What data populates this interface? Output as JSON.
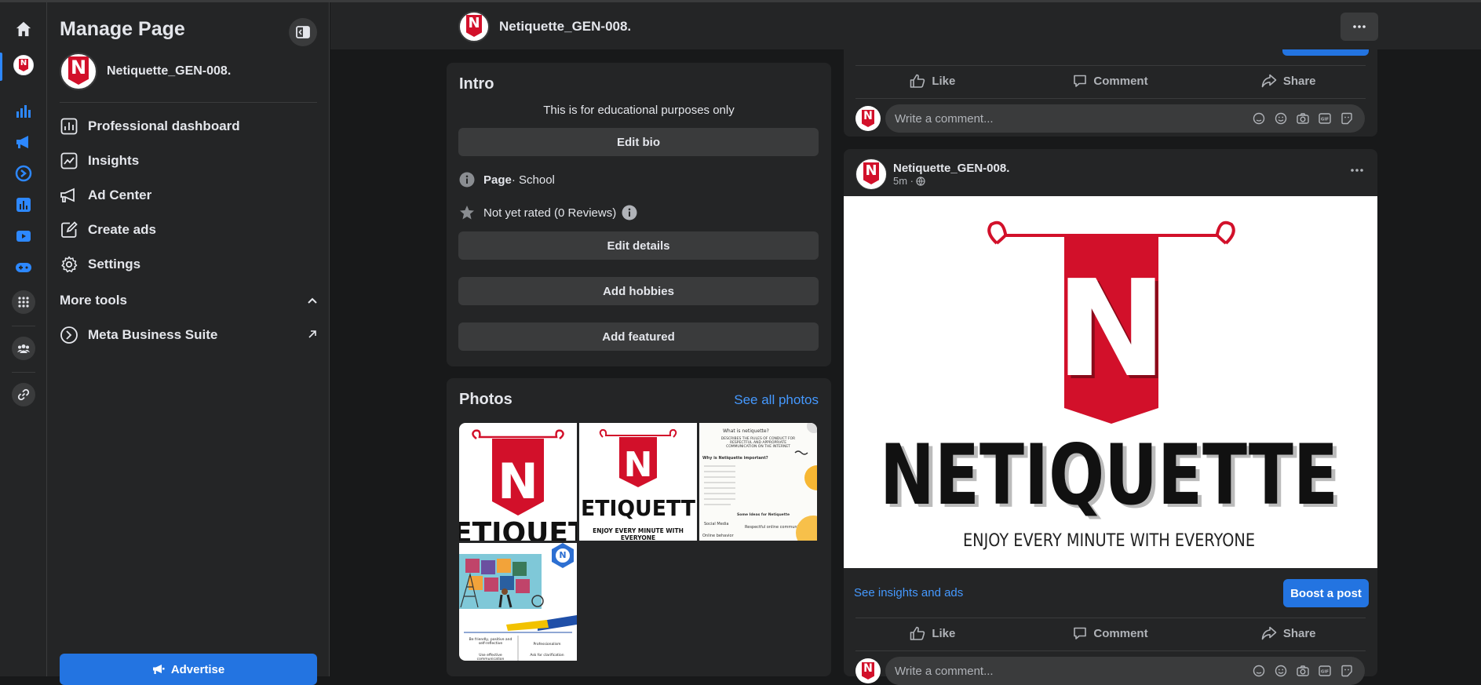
{
  "colors": {
    "accent": "#2374e1",
    "link": "#4599ff",
    "brand_red": "#d2102a",
    "bg": "#18191a",
    "surface": "#242526"
  },
  "rail": {
    "icons": [
      "home-icon",
      "page-avatar",
      "insights-bar-chart-icon",
      "ad-megaphone-icon",
      "meta-business-suite-icon",
      "analytics-icon",
      "video-play-icon",
      "gaming-controller-icon",
      "apps-grid-icon",
      "groups-icon",
      "link-icon"
    ]
  },
  "sidebar": {
    "title": "Manage Page",
    "page_name": "Netiquette_GEN-008.",
    "items": [
      {
        "label": "Professional dashboard",
        "icon": "dashboard-icon"
      },
      {
        "label": "Insights",
        "icon": "insights-icon"
      },
      {
        "label": "Ad Center",
        "icon": "megaphone-icon"
      },
      {
        "label": "Create ads",
        "icon": "pencil-icon"
      },
      {
        "label": "Settings",
        "icon": "gear-icon"
      }
    ],
    "more_tools_label": "More tools",
    "tools": [
      {
        "label": "Meta Business Suite",
        "icon": "meta-business-suite-icon"
      }
    ],
    "advertise_label": "Advertise"
  },
  "header": {
    "page_name": "Netiquette_GEN-008."
  },
  "intro": {
    "title": "Intro",
    "bio": "This is for educational purposes only",
    "edit_bio": "Edit bio",
    "category_bold": "Page",
    "category_rest": " · School",
    "rating": "Not yet rated (0 Reviews)",
    "edit_details": "Edit details",
    "add_hobbies": "Add hobbies",
    "add_featured": "Add featured"
  },
  "photos": {
    "title": "Photos",
    "see_all": "See all photos",
    "thumb2_caption": "ENJOY EVERY MINUTE WITH EVERYONE",
    "thumb3": {
      "heading": "What is netiquette?",
      "line1": "DESCRIBES THE RULES OF CONDUCT FOR RESPECTFUL AND APPROPRIATE COMMUNICATION ON THE INTERNET",
      "q": "Why is Netiquette important?",
      "ideas": "Some Ideas for Netiquette",
      "social": "Social Media",
      "respect": "Respectful online communication",
      "online": "Online behavior"
    },
    "thumb4": {
      "badge": "N",
      "l1": "Be friendly, positive and self-reflective",
      "l2": "Professionalism",
      "l3": "Use effective communication",
      "l4": "Ask for clarification"
    }
  },
  "posts": {
    "actions": {
      "like": "Like",
      "comment": "Comment",
      "share": "Share"
    },
    "comment_placeholder": "Write a comment...",
    "post": {
      "author": "Netiquette_GEN-008.",
      "time": "5m ·",
      "image_word": "NETIQUETTE",
      "image_tagline": "ENJOY EVERY MINUTE WITH EVERYONE",
      "logo_letter": "N",
      "insights_link": "See insights and ads",
      "boost": "Boost a post"
    }
  }
}
